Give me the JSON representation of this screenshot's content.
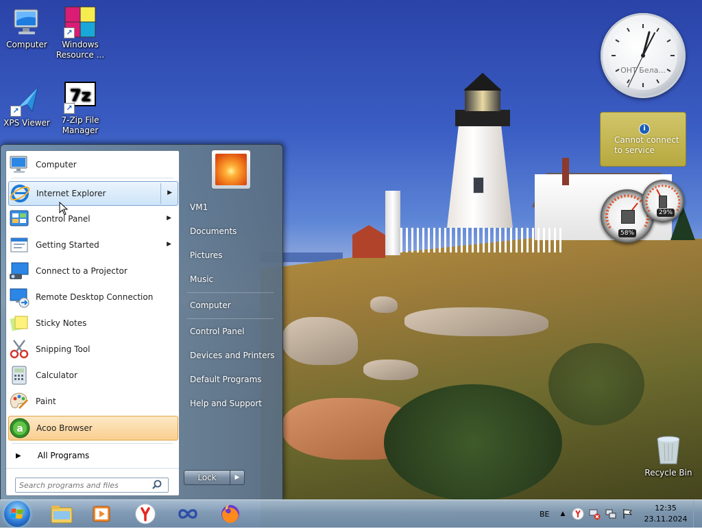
{
  "desktop": {
    "icons": [
      {
        "label": "Computer"
      },
      {
        "label": "Windows Resource ..."
      },
      {
        "label": "XPS Viewer"
      },
      {
        "label": "7-Zip File Manager"
      },
      {
        "label": "Recycle Bin"
      }
    ],
    "sevenzip_glyph": "7z"
  },
  "gadgets": {
    "clock_label": "ОНТ Бела...",
    "weather_message": "Cannot connect to service",
    "weather_info_glyph": "i",
    "cpu_percent": "58%",
    "ram_percent": "29%"
  },
  "start_menu": {
    "programs": [
      {
        "label": "Computer",
        "icon": "computer-icon"
      },
      {
        "label": "Internet Explorer",
        "icon": "internet-explorer-icon",
        "has_submenu": true,
        "state": "hover"
      },
      {
        "label": "Control Panel",
        "icon": "control-panel-icon",
        "has_submenu": true
      },
      {
        "label": "Getting Started",
        "icon": "getting-started-icon",
        "has_submenu": true
      },
      {
        "label": "Connect to a Projector",
        "icon": "projector-icon"
      },
      {
        "label": "Remote Desktop Connection",
        "icon": "remote-desktop-icon"
      },
      {
        "label": "Sticky Notes",
        "icon": "sticky-notes-icon"
      },
      {
        "label": "Snipping Tool",
        "icon": "snipping-tool-icon"
      },
      {
        "label": "Calculator",
        "icon": "calculator-icon"
      },
      {
        "label": "Paint",
        "icon": "paint-icon"
      },
      {
        "label": "Acoo Browser",
        "icon": "acoo-browser-icon",
        "state": "newly-installed"
      }
    ],
    "all_programs": "All Programs",
    "search_placeholder": "Search programs and files",
    "right_items": [
      {
        "label": "VM1"
      },
      {
        "label": "Documents"
      },
      {
        "label": "Pictures"
      },
      {
        "label": "Music"
      },
      {
        "label": "Computer"
      },
      {
        "label": "Control Panel"
      },
      {
        "label": "Devices and Printers"
      },
      {
        "label": "Default Programs"
      },
      {
        "label": "Help and Support"
      }
    ],
    "lock_label": "Lock"
  },
  "taskbar": {
    "pinned": [
      {
        "name": "file-explorer-icon"
      },
      {
        "name": "media-player-icon"
      },
      {
        "name": "yandex-browser-icon"
      },
      {
        "name": "infinity-app-icon"
      },
      {
        "name": "firefox-icon"
      }
    ],
    "language": "BE",
    "time": "12:35",
    "date": "23.11.2024"
  },
  "colors": {
    "accent_hover": "#cde4f9",
    "new_program_highlight": "#f9cf8f",
    "weather_gadget": "#c8bb52"
  }
}
